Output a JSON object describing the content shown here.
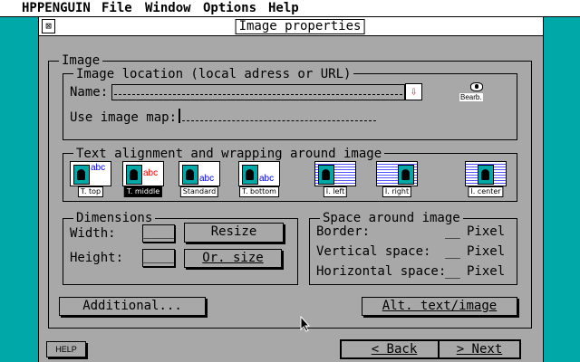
{
  "menubar": {
    "app": "HPPENGUIN",
    "items": [
      "File",
      "Window",
      "Options",
      "Help"
    ]
  },
  "window": {
    "title": "Image properties",
    "close_glyph": "⊠"
  },
  "image_group": {
    "title": "Image",
    "location": {
      "title": "Image location (local adress or URL)",
      "name_label": "Name:",
      "name_value": "",
      "dropdown_glyph": "⇩",
      "browse_label": "Bearb.",
      "imagemap_label": "Use image map:",
      "imagemap_value": ""
    }
  },
  "alignment": {
    "title": "Text alignment and wrapping around image",
    "sample_text": "abc",
    "options": [
      {
        "label": "T. top",
        "selected": false
      },
      {
        "label": "T. middle",
        "selected": true
      },
      {
        "label": "Standard",
        "selected": false
      },
      {
        "label": "T. bottom",
        "selected": false
      },
      {
        "label": "I. left",
        "selected": false
      },
      {
        "label": "I. right",
        "selected": false
      },
      {
        "label": "I. center",
        "selected": false
      }
    ]
  },
  "dimensions": {
    "title": "Dimensions",
    "width_label": "Width:",
    "width_value": "____",
    "height_label": "Height:",
    "height_value": "____",
    "resize_label": "Resize",
    "origsize_label": "Or. size"
  },
  "space": {
    "title": "Space around image",
    "border_label": "Border:",
    "border_value": "__",
    "vertical_label": "Vertical space:",
    "vertical_value": "__",
    "horizontal_label": "Horizontal space:",
    "horizontal_value": "__",
    "unit": "Pixel"
  },
  "buttons": {
    "additional": "Additional...",
    "alt": "Alt. text/image",
    "help": "HELP",
    "back": "< Back",
    "next": "> Next"
  },
  "colors": {
    "desktop": "#00a8a8",
    "window": "#a8a8a8",
    "accent_red": "#ff0000",
    "accent_blue": "#0000ff"
  }
}
